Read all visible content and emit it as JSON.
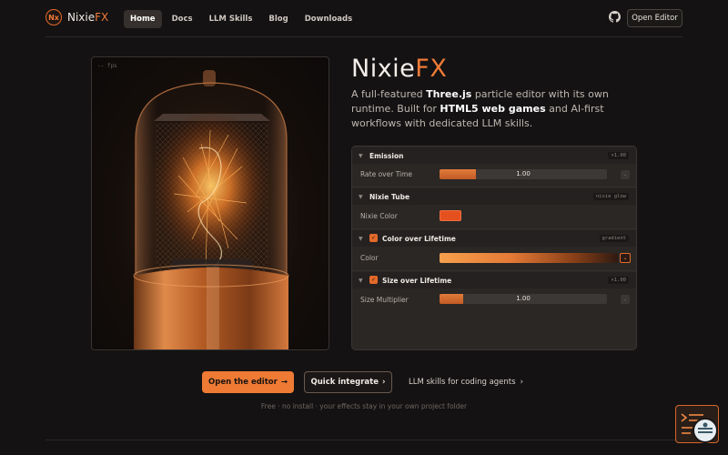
{
  "nav": {
    "brand": "Nixie",
    "brand_fx": "FX",
    "logo_text": "Nx",
    "links": [
      "Home",
      "Docs",
      "LLM Skills",
      "Blog",
      "Downloads"
    ],
    "active": "Home",
    "open_editor": "Open Editor"
  },
  "hero": {
    "fps": "-- fps",
    "title": "Nixie",
    "title_fx": "FX",
    "desc_1": "A full-featured ",
    "desc_b1": "Three.js",
    "desc_2": " particle editor with its own runtime. Built for ",
    "desc_b2": "HTML5 web games",
    "desc_3": " and AI-first workflows with dedicated LLM skills."
  },
  "panel": {
    "emission": {
      "title": "Emission",
      "tag": "×1.00",
      "row_label": "Rate over Time",
      "value": "1.00",
      "fill": 0.22
    },
    "nixie": {
      "title": "Nixie Tube",
      "tag": "nixie glow",
      "row_label": "Nixie Color",
      "color": "#e4501e"
    },
    "col": {
      "title": "Color over Lifetime",
      "tag": "gradient",
      "row_label": "Color"
    },
    "size": {
      "title": "Size over Lifetime",
      "tag": "×1.00",
      "row_label": "Size Multiplier",
      "value": "1.00",
      "fill": 0.14
    }
  },
  "cta": {
    "primary": "Open the editor",
    "secondary": "Quick integrate",
    "link": "LLM skills for coding agents",
    "footnote": "Free · no install · your effects stay in your own project folder"
  },
  "colors": {
    "accent": "#ee7a34",
    "bg": "#141213",
    "panel": "#2a2725"
  },
  "icons": [
    "github-icon",
    "arrow-right-icon",
    "chevron-right-icon",
    "chevron-down-icon",
    "check-icon",
    "terminal-icon"
  ]
}
